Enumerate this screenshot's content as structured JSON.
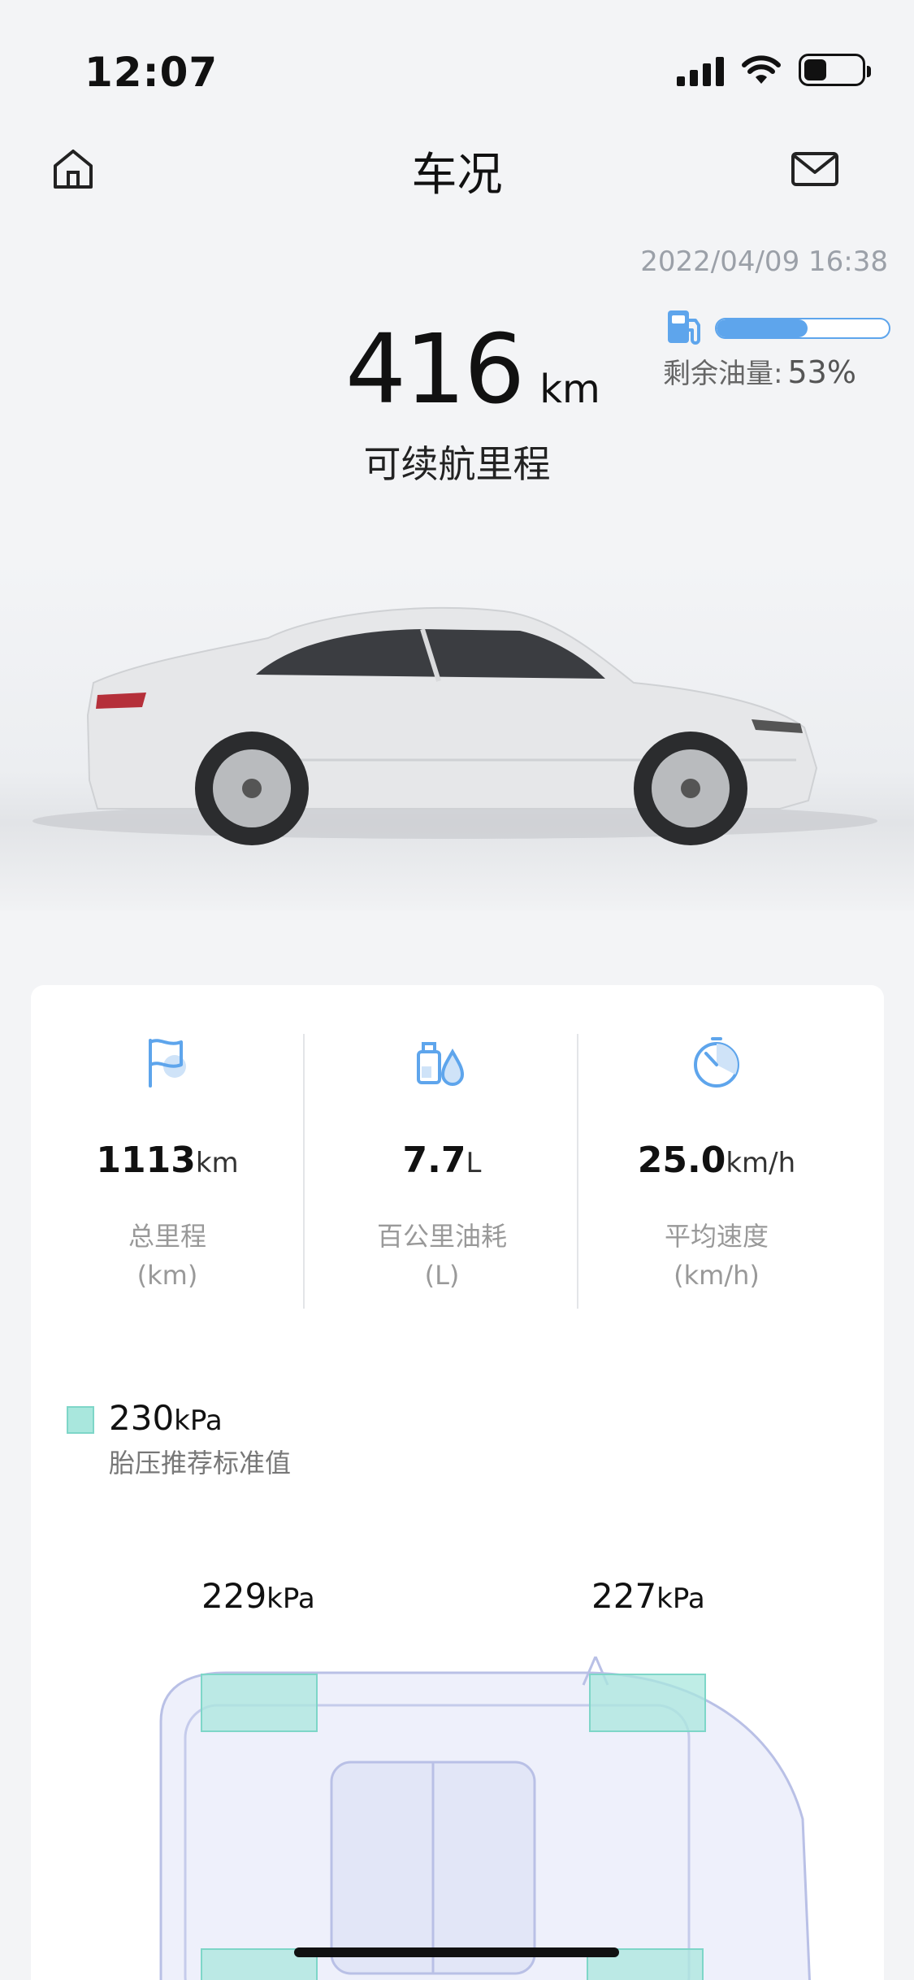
{
  "status_bar": {
    "time": "12:07"
  },
  "header": {
    "title": "车况"
  },
  "range": {
    "timestamp": "2022/04/09 16:38",
    "value": "416",
    "unit": "km",
    "label": "可续航里程"
  },
  "fuel": {
    "label": "剩余油量:",
    "percent_text": "53%",
    "level": 0.53
  },
  "stats": [
    {
      "value": "1113",
      "unit": "km",
      "label": "总里程",
      "sub": "(km)",
      "icon": "flag-icon"
    },
    {
      "value": "7.7",
      "unit": "L",
      "label": "百公里油耗",
      "sub": "(L)",
      "icon": "oil-drop-icon"
    },
    {
      "value": "25.0",
      "unit": "km/h",
      "label": "平均速度",
      "sub": "(km/h)",
      "icon": "speedometer-icon"
    }
  ],
  "tire": {
    "recommended_value": "230",
    "recommended_unit": "kPa",
    "recommended_label": "胎压推荐标准值",
    "rear_left": {
      "value": "229",
      "unit": "kPa"
    },
    "front_left": {
      "value": "227",
      "unit": "kPa"
    }
  },
  "colors": {
    "accent": "#5ea5ec",
    "tire_ok": "#a9e7dd"
  }
}
